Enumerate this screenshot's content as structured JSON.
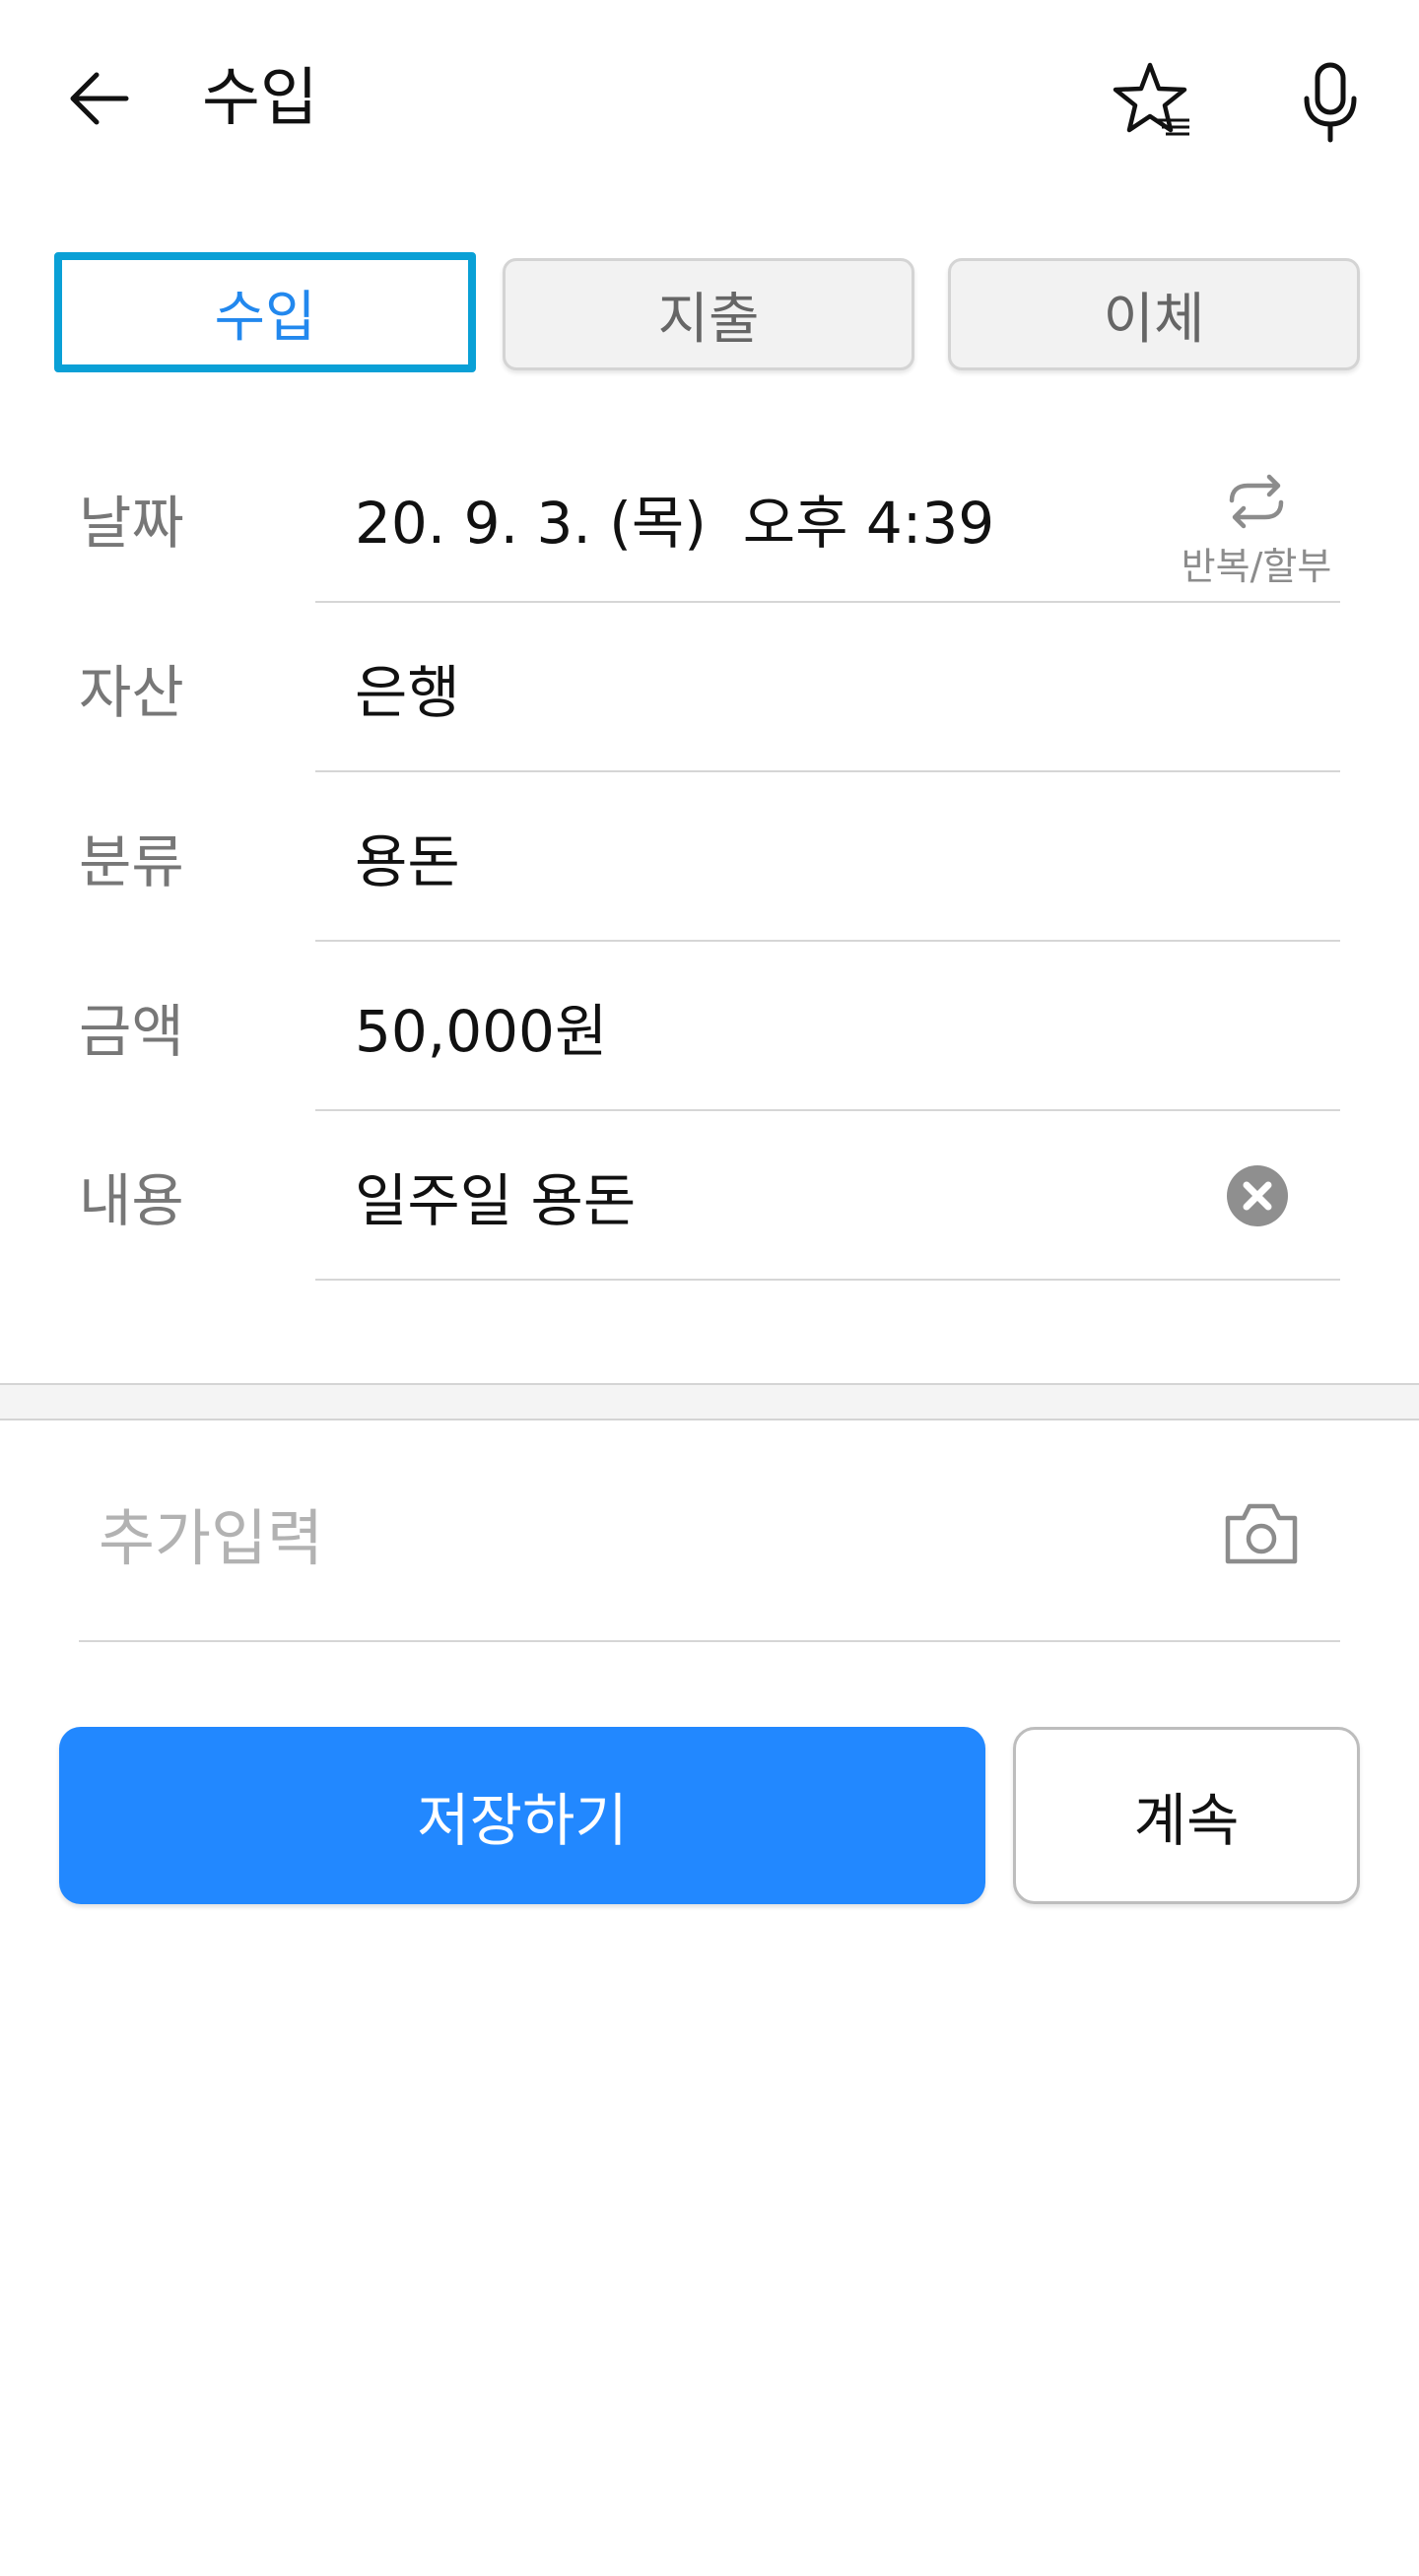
{
  "header": {
    "title": "수입",
    "back_icon": "arrow-left-icon",
    "favorites_icon": "star-list-icon",
    "voice_icon": "microphone-icon"
  },
  "tabs": [
    {
      "label": "수입",
      "active": true
    },
    {
      "label": "지출",
      "active": false
    },
    {
      "label": "이체",
      "active": false
    }
  ],
  "form": {
    "date": {
      "label": "날짜",
      "value": "20. 9. 3. (목)  오후 4:39",
      "repeat_label": "반복/할부",
      "repeat_icon": "repeat-icon"
    },
    "asset": {
      "label": "자산",
      "value": "은행"
    },
    "category": {
      "label": "분류",
      "value": "용돈"
    },
    "amount": {
      "label": "금액",
      "value": "50,000원"
    },
    "memo": {
      "label": "내용",
      "value": "일주일 용돈",
      "clear_icon": "clear-icon"
    }
  },
  "extra": {
    "placeholder": "추가입력",
    "camera_icon": "camera-icon"
  },
  "actions": {
    "save_label": "저장하기",
    "continue_label": "계속"
  },
  "colors": {
    "accent": "#2288ff",
    "active_tab_border": "#0aa0d6",
    "active_tab_text": "#2288ee"
  }
}
